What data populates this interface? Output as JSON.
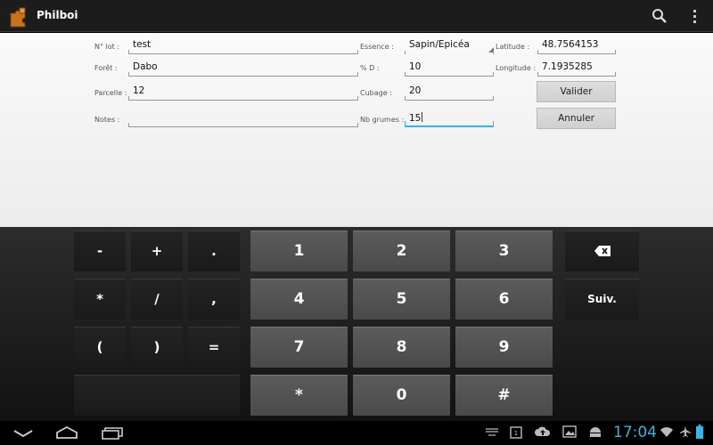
{
  "app": {
    "title": "Philboi",
    "icon": "puzzle-icon",
    "actions": [
      "search-icon",
      "overflow-menu-icon"
    ]
  },
  "form": {
    "lot_label": "N° lot :",
    "lot_value": "test",
    "foret_label": "Forêt :",
    "foret_value": "Dabo",
    "parcelle_label": "Parcelle :",
    "parcelle_value": "12",
    "notes_label": "Notes :",
    "notes_value": "",
    "essence_label": "Essence :",
    "essence_value": "Sapin/Epicéa",
    "pd_label": "% D :",
    "pd_value": "10",
    "cubage_label": "Cubage :",
    "cubage_value": "20",
    "grumes_label": "Nb grumes :",
    "grumes_value": "15",
    "latitude_label": "Latitude :",
    "latitude_value": "48.7564153",
    "longitude_label": "Longitude :",
    "longitude_value": "7.1935285",
    "valider_label": "Valider",
    "annuler_label": "Annuler"
  },
  "keyboard": {
    "symbols": [
      "-",
      "+",
      ".",
      "*",
      "/",
      ",",
      "(",
      ")",
      "="
    ],
    "digits": [
      "1",
      "2",
      "3",
      "4",
      "5",
      "6",
      "7",
      "8",
      "9",
      "*",
      "0",
      "#"
    ],
    "next_label": "Suiv.",
    "backspace_icon": "backspace-icon"
  },
  "system_bar": {
    "time": "17:04",
    "nav_icons": [
      "back-icon",
      "home-icon",
      "recent-apps-icon"
    ],
    "status_icons": [
      "keyboard-icon",
      "screenshot-icon",
      "upload-icon",
      "gallery-icon",
      "android-icon",
      "wifi-icon",
      "airplane-icon",
      "battery-icon"
    ]
  },
  "colors": {
    "accent": "#33b5e5",
    "actionbar": "#1c1c1c",
    "form_bg": "#f2f2f2",
    "key_dark": "#1f1f1f",
    "key_num": "#555555"
  }
}
